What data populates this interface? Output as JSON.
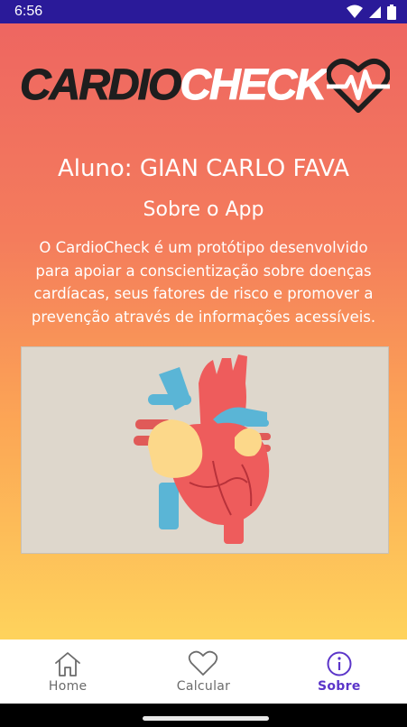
{
  "status_bar": {
    "time": "6:56",
    "icons": [
      "wifi-icon",
      "signal-icon",
      "battery-icon"
    ]
  },
  "logo": {
    "part1": "CARDIO",
    "part2": "CHECK",
    "heart_icon": "heartbeat-icon"
  },
  "student": {
    "label": "Aluno: GIAN CARLO FAVA"
  },
  "about": {
    "title": "Sobre o App",
    "text": "O CardioCheck é um protótipo desenvolvido para apoiar a conscientização sobre doenças cardíacas, seus fatores de risco e promover a prevenção através de informações acessíveis."
  },
  "bottom_nav": {
    "items": [
      {
        "label": "Home",
        "icon": "home-icon",
        "active": false
      },
      {
        "label": "Calcular",
        "icon": "heart-icon",
        "active": false
      },
      {
        "label": "Sobre",
        "icon": "info-icon",
        "active": true
      }
    ]
  },
  "colors": {
    "status_bar": "#2a1a99",
    "gradient_top": "#ee6661",
    "gradient_bottom": "#fed35c",
    "active_nav": "#5b35c9"
  }
}
